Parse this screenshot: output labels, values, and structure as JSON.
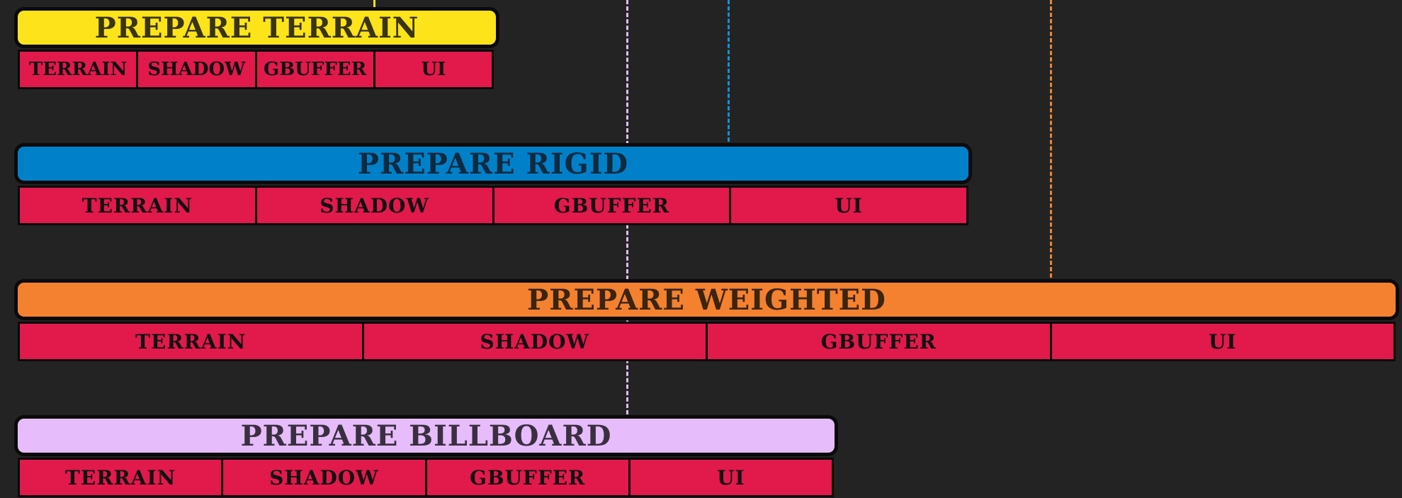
{
  "colors": {
    "background": "#232323",
    "cell": "#e2194b",
    "terrain": "#fde31a",
    "rigid": "#0080c8",
    "weighted": "#f4812f",
    "billboard": "#e6bcfa"
  },
  "groups": [
    {
      "id": "terrain",
      "title": "PREPARE TERRAIN",
      "cells": [
        "TERRAIN",
        "SHADOW",
        "GBUFFER",
        "UI"
      ]
    },
    {
      "id": "rigid",
      "title": "PREPARE RIGID",
      "cells": [
        "TERRAIN",
        "SHADOW",
        "GBUFFER",
        "UI"
      ]
    },
    {
      "id": "weighted",
      "title": "PREPARE WEIGHTED",
      "cells": [
        "TERRAIN",
        "SHADOW",
        "GBUFFER",
        "UI"
      ]
    },
    {
      "id": "billboard",
      "title": "PREPARE BILLBOARD",
      "cells": [
        "TERRAIN",
        "SHADOW",
        "GBUFFER",
        "UI"
      ]
    }
  ]
}
